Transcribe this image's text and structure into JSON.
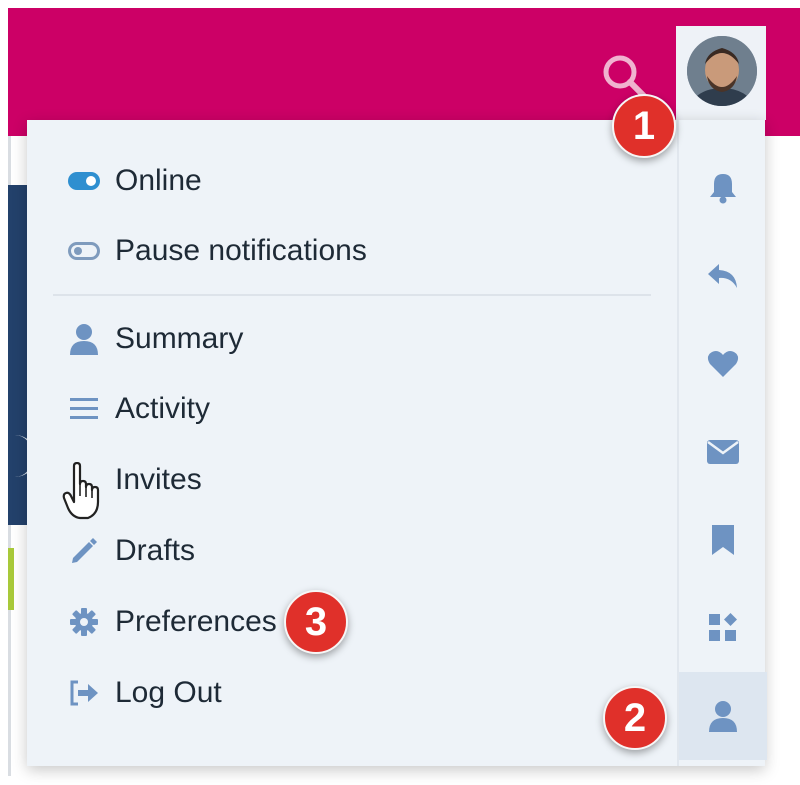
{
  "colors": {
    "header_bg": "#cc0066",
    "menu_bg": "#eef3f8",
    "icon_blue": "#6e93c2",
    "toggle_on": "#2f8fd0",
    "badge_red": "#e0302a",
    "text": "#1e2a36"
  },
  "header": {
    "search_icon": "search-icon",
    "avatar_icon": "user-avatar"
  },
  "user_menu": {
    "status_items": [
      {
        "label": "Online",
        "icon": "toggle-on-icon"
      },
      {
        "label": "Pause notifications",
        "icon": "toggle-off-icon"
      }
    ],
    "items": [
      {
        "label": "Summary",
        "icon": "user-icon"
      },
      {
        "label": "Activity",
        "icon": "list-icon"
      },
      {
        "label": "Invites",
        "icon": "pointer-hand-icon"
      },
      {
        "label": "Drafts",
        "icon": "pencil-icon"
      },
      {
        "label": "Preferences",
        "icon": "gear-icon"
      },
      {
        "label": "Log Out",
        "icon": "sign-out-icon"
      }
    ],
    "rail_icons": [
      "bell-icon",
      "reply-icon",
      "heart-icon",
      "envelope-icon",
      "bookmark-icon",
      "widgets-icon",
      "user-icon"
    ]
  },
  "callouts": {
    "one": "1",
    "two": "2",
    "three": "3"
  }
}
